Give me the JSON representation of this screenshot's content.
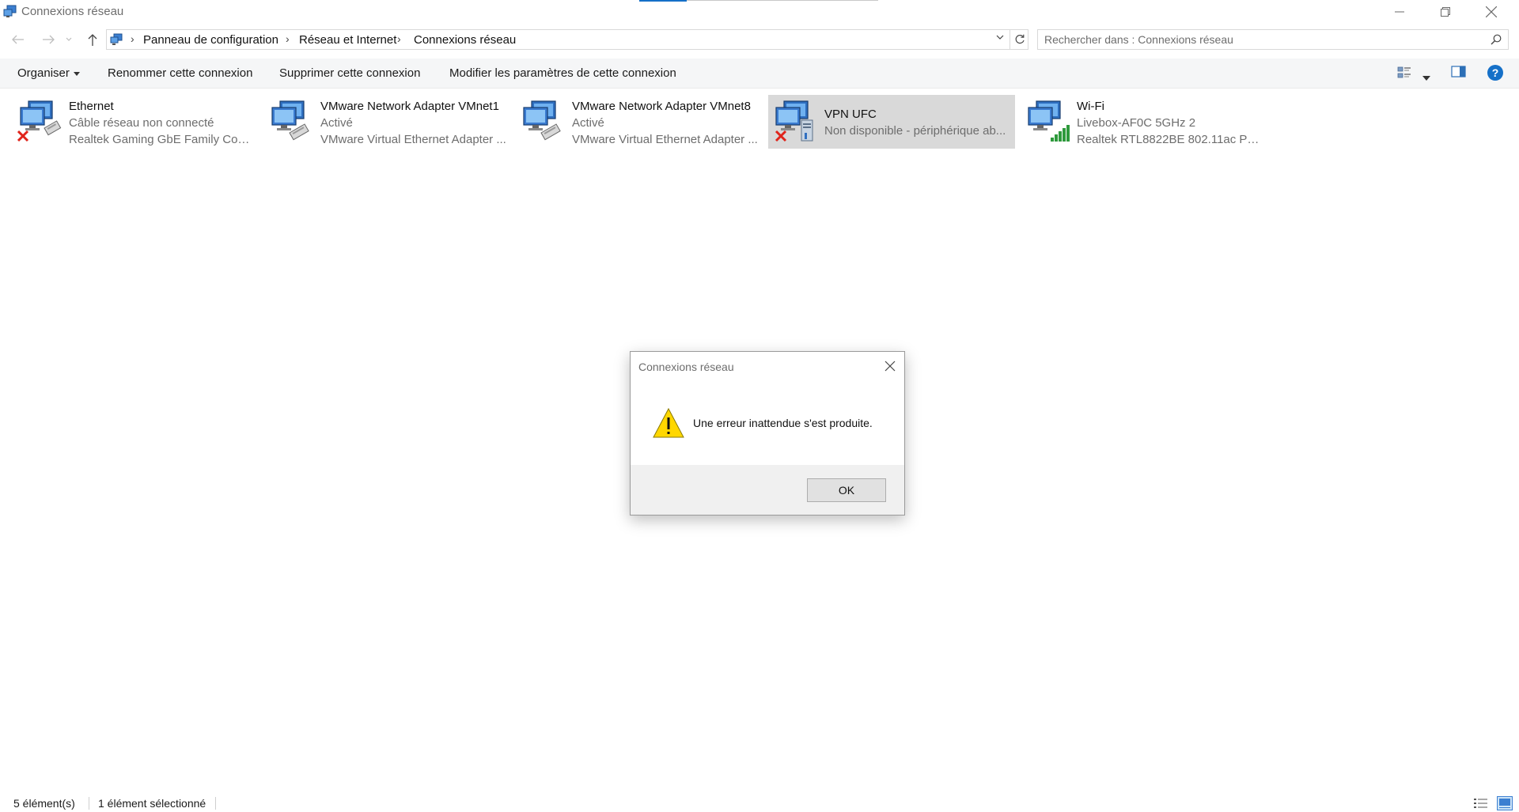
{
  "window": {
    "title": "Connexions réseau"
  },
  "address": {
    "crumbs": [
      "Panneau de configuration",
      "Réseau et Internet",
      "Connexions réseau"
    ]
  },
  "search": {
    "placeholder": "Rechercher dans : Connexions réseau"
  },
  "toolbar": {
    "organize_label": "Organiser",
    "rename_label": "Renommer cette connexion",
    "delete_label": "Supprimer cette connexion",
    "modify_label": "Modifier les paramètres de cette connexion"
  },
  "connections": [
    {
      "name": "Ethernet",
      "status": "Câble réseau non connecté",
      "device": "Realtek Gaming GbE Family Contr...",
      "icon": "ethernet-disconnected-icon"
    },
    {
      "name": "VMware Network Adapter VMnet1",
      "status": "Activé",
      "device": "VMware Virtual Ethernet Adapter ...",
      "icon": "ethernet-adapter-icon"
    },
    {
      "name": "VMware Network Adapter VMnet8",
      "status": "Activé",
      "device": "VMware Virtual Ethernet Adapter ...",
      "icon": "ethernet-adapter-icon"
    },
    {
      "name": "VPN UFC",
      "status": "Non disponible - périphérique ab...",
      "device": "",
      "icon": "vpn-disconnected-icon",
      "selected": true
    },
    {
      "name": "Wi-Fi",
      "status": "Livebox-AF0C 5GHz 2",
      "device": "Realtek RTL8822BE 802.11ac PCIe ...",
      "icon": "wifi-signal-icon"
    }
  ],
  "dialog": {
    "title": "Connexions réseau",
    "message": "Une erreur inattendue s'est produite.",
    "ok_label": "OK"
  },
  "statusbar": {
    "count": "5 élément(s)",
    "selected": "1 élément sélectionné"
  },
  "colors": {
    "selection": "#d9d9d9",
    "accent": "#1570c8",
    "error_red": "#e0241b",
    "warning_yellow": "#ffd700"
  }
}
